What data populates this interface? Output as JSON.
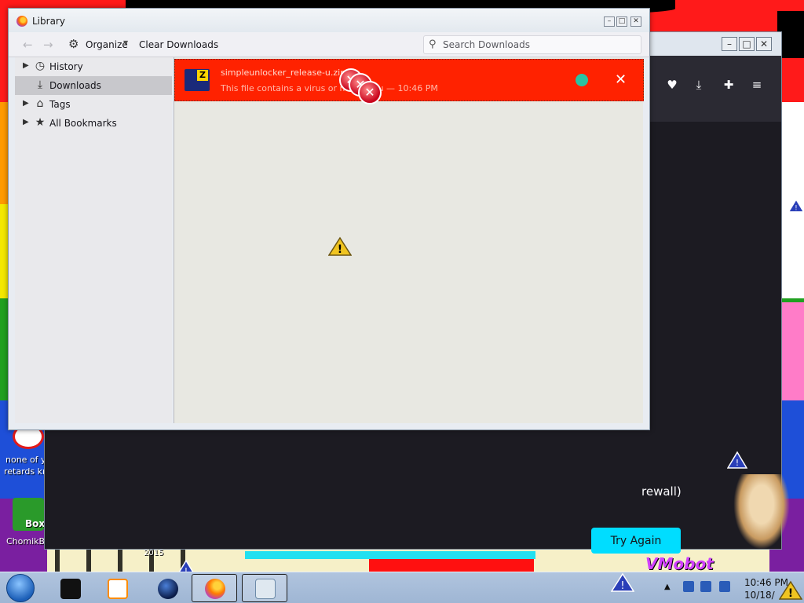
{
  "library": {
    "title": "Library",
    "toolbar": {
      "organize_label": "Organize",
      "clear_downloads_label": "Clear Downloads",
      "search_placeholder": "Search Downloads"
    },
    "sidebar": {
      "items": [
        {
          "label": "History",
          "icon": "history-icon",
          "expandable": true,
          "selected": false
        },
        {
          "label": "Downloads",
          "icon": "download-icon",
          "expandable": false,
          "selected": true
        },
        {
          "label": "Tags",
          "icon": "tag-icon",
          "expandable": true,
          "selected": false
        },
        {
          "label": "All Bookmarks",
          "icon": "star-icon",
          "expandable": true,
          "selected": false
        }
      ]
    },
    "downloads": [
      {
        "filename": "simpleunlocker_release-u.zip",
        "status": "This file contains a virus or ma         1nc.ru — 10:46 PM",
        "icon": "zip-file-icon"
      }
    ]
  },
  "background_browser": {
    "partial_text": "rewall)",
    "try_again_label": "Try Again"
  },
  "desktop": {
    "icon_labels": [
      "none of y",
      "retards kn",
      "ChomikB"
    ],
    "box_label": "Box",
    "year_text": "2015",
    "vmobot_text": "VMobot"
  },
  "taskbar": {
    "clock_time": "10:46 PM",
    "clock_date": "10/18/"
  },
  "colors": {
    "download_error_bg": "#ff2200",
    "try_again_bg": "#00ddff",
    "status_dot": "#2ac3a2"
  }
}
